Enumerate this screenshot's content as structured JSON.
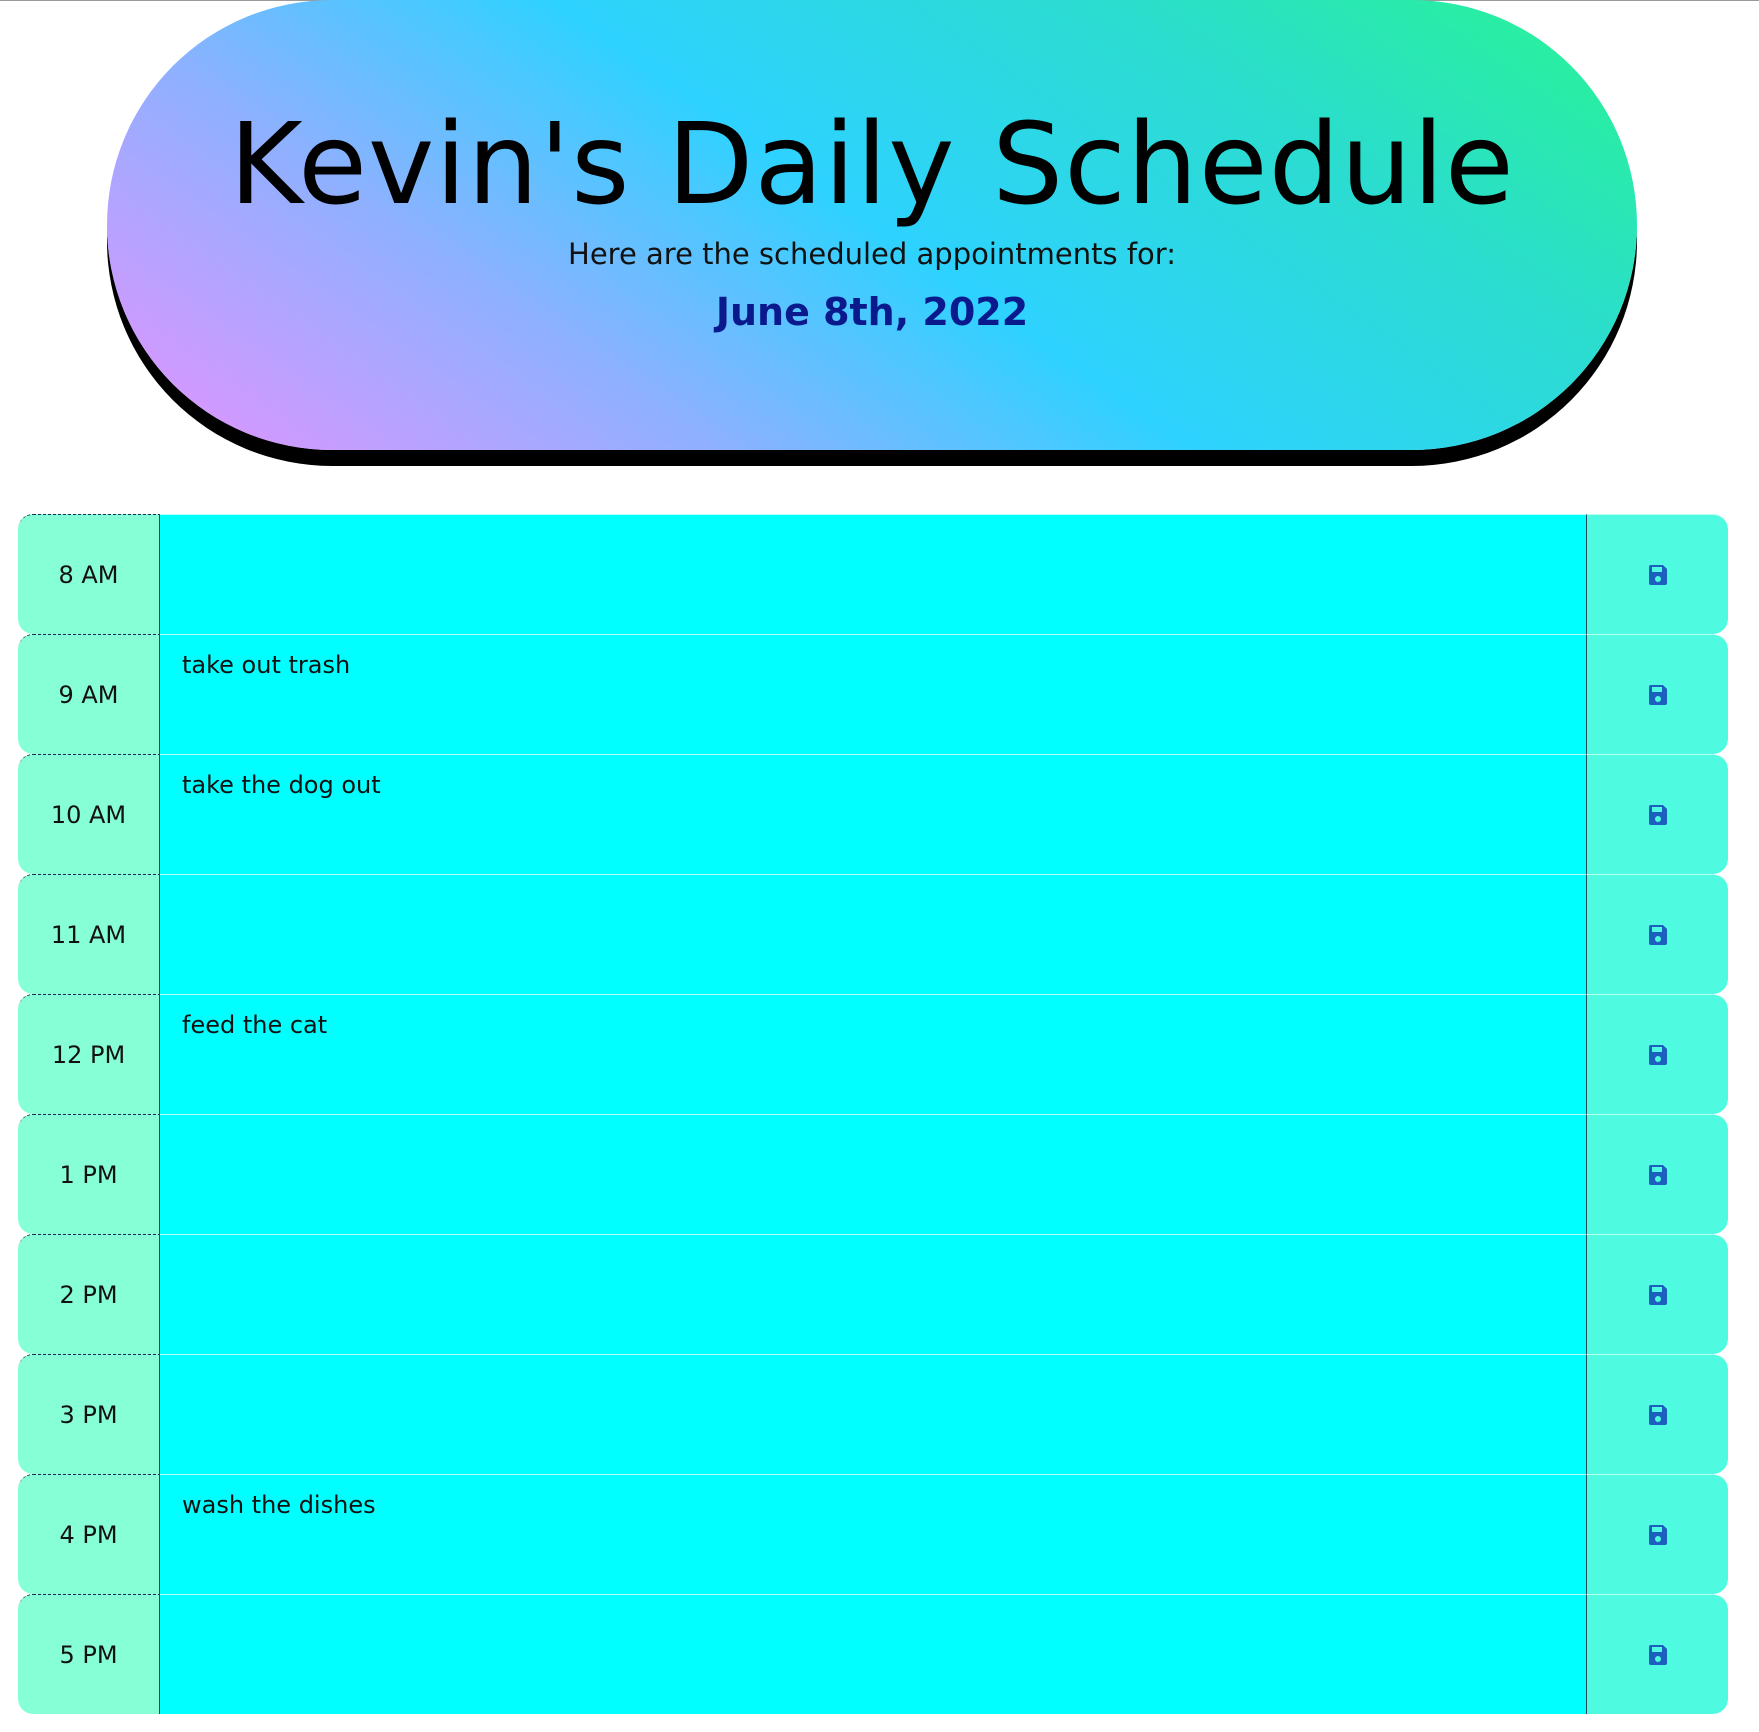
{
  "header": {
    "title": "Kevin's Daily Schedule",
    "subtitle": "Here are the scheduled appointments for:",
    "date": "June 8th, 2022"
  },
  "colors": {
    "hour_bg": "#86ffd6",
    "description_bg": "#00ffff",
    "save_bg": "#4efbe0",
    "date_text": "#0a1a8c",
    "save_icon": "#1c5fbf"
  },
  "schedule": [
    {
      "hour": "8 AM",
      "description": "",
      "save_icon": "floppy-disk-icon"
    },
    {
      "hour": "9 AM",
      "description": "take out trash",
      "save_icon": "floppy-disk-icon"
    },
    {
      "hour": "10 AM",
      "description": "take the dog out",
      "save_icon": "floppy-disk-icon"
    },
    {
      "hour": "11 AM",
      "description": "",
      "save_icon": "floppy-disk-icon"
    },
    {
      "hour": "12 PM",
      "description": "feed the cat",
      "save_icon": "floppy-disk-icon"
    },
    {
      "hour": "1 PM",
      "description": "",
      "save_icon": "floppy-disk-icon"
    },
    {
      "hour": "2 PM",
      "description": "",
      "save_icon": "floppy-disk-icon"
    },
    {
      "hour": "3 PM",
      "description": "",
      "save_icon": "floppy-disk-icon"
    },
    {
      "hour": "4 PM",
      "description": "wash the dishes",
      "save_icon": "floppy-disk-icon"
    },
    {
      "hour": "5 PM",
      "description": "",
      "save_icon": "floppy-disk-icon"
    }
  ]
}
